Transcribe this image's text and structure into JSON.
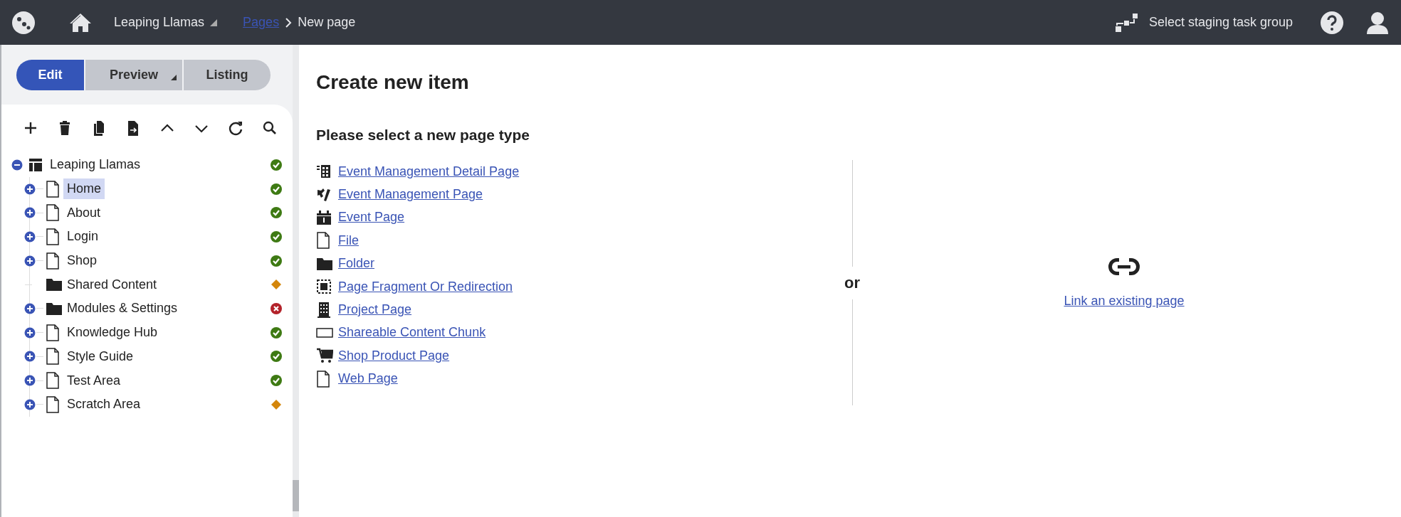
{
  "top_bar": {
    "site": {
      "label": "Leaping Llamas",
      "dropdown": true
    },
    "breadcrumbs": [
      {
        "label": "Pages",
        "link": true
      },
      {
        "label": "New page",
        "link": false
      }
    ],
    "staging": {
      "label": "Select staging task group"
    }
  },
  "mode_tabs": [
    {
      "label": "Edit",
      "selected": true,
      "dropdown": false
    },
    {
      "label": "Preview",
      "selected": false,
      "dropdown": true
    },
    {
      "label": "Listing",
      "selected": false,
      "dropdown": false
    }
  ],
  "toolbar": [
    {
      "kind": "add"
    },
    {
      "kind": "delete"
    },
    {
      "kind": "copy"
    },
    {
      "kind": "move"
    },
    {
      "kind": "up"
    },
    {
      "kind": "down"
    },
    {
      "kind": "refresh"
    },
    {
      "kind": "search"
    }
  ],
  "tree": {
    "label": "Leaping Llamas",
    "kind": "site",
    "has_children": true,
    "expanded": true,
    "status": {
      "kind": "published"
    },
    "selected": false,
    "children": [
      {
        "label": "Home",
        "kind": "page",
        "has_children": true,
        "expanded": false,
        "status": {
          "kind": "published"
        },
        "selected": true
      },
      {
        "label": "About",
        "kind": "page",
        "has_children": true,
        "expanded": false,
        "status": {
          "kind": "published"
        },
        "selected": false
      },
      {
        "label": "Login",
        "kind": "page",
        "has_children": true,
        "expanded": false,
        "status": {
          "kind": "published"
        },
        "selected": false
      },
      {
        "label": "Shop",
        "kind": "page",
        "has_children": true,
        "expanded": false,
        "status": {
          "kind": "published"
        },
        "selected": false
      },
      {
        "label": "Shared Content",
        "kind": "folder",
        "has_children": false,
        "status": {
          "kind": "pending"
        },
        "selected": false
      },
      {
        "label": "Modules & Settings",
        "kind": "folder",
        "has_children": true,
        "expanded": false,
        "status": {
          "kind": "error"
        },
        "selected": false
      },
      {
        "label": "Knowledge Hub",
        "kind": "page",
        "has_children": true,
        "expanded": false,
        "status": {
          "kind": "published"
        },
        "selected": false
      },
      {
        "label": "Style Guide",
        "kind": "page",
        "has_children": true,
        "expanded": false,
        "status": {
          "kind": "published"
        },
        "selected": false
      },
      {
        "label": "Test Area",
        "kind": "page",
        "has_children": true,
        "expanded": false,
        "status": {
          "kind": "published"
        },
        "selected": false
      },
      {
        "label": "Scratch Area",
        "kind": "page",
        "has_children": true,
        "expanded": false,
        "status": {
          "kind": "pending"
        },
        "selected": false
      }
    ]
  },
  "content": {
    "title": "Create new item",
    "subtitle": "Please select a new page type",
    "page_types": [
      {
        "label": "Event Management Detail Page",
        "kind": "grid"
      },
      {
        "label": "Event Management Page",
        "kind": "tools"
      },
      {
        "label": "Event Page",
        "kind": "calendar"
      },
      {
        "label": "File",
        "kind": "page"
      },
      {
        "label": "Folder",
        "kind": "folder"
      },
      {
        "label": "Page Fragment Or Redirection",
        "kind": "fragment"
      },
      {
        "label": "Project Page",
        "kind": "building"
      },
      {
        "label": "Shareable Content Chunk",
        "kind": "chunk"
      },
      {
        "label": "Shop Product Page",
        "kind": "cart"
      },
      {
        "label": "Web Page",
        "kind": "page"
      }
    ],
    "separator": "or",
    "link_existing": "Link an existing page"
  }
}
